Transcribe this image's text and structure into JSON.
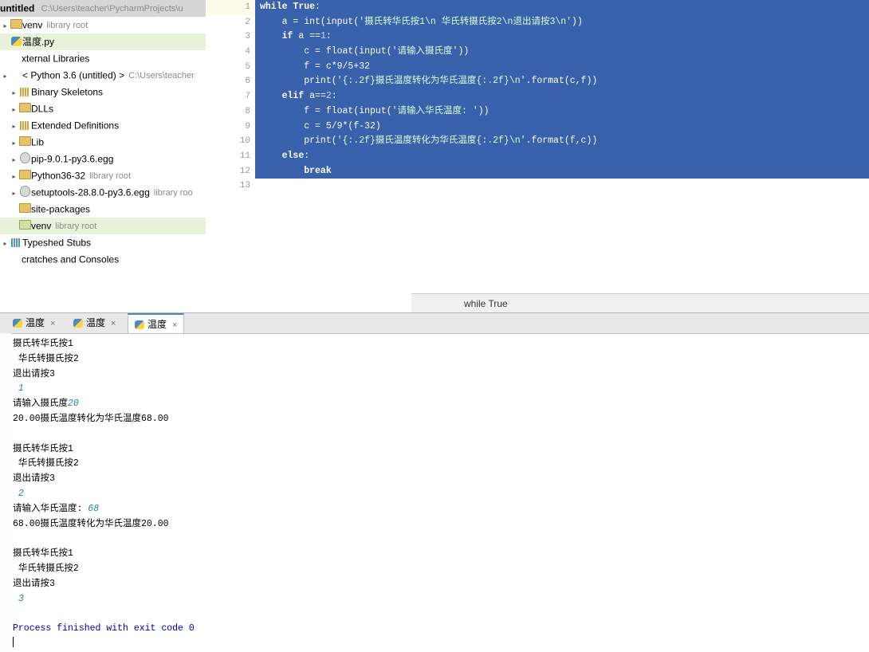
{
  "project": {
    "root_label": "untitled",
    "root_path": "C:\\Users\\teacher\\PycharmProjects\\u",
    "items": [
      {
        "label": "venv",
        "sub": "library root",
        "icon": "folder-icon",
        "indent": 1,
        "arrow": ">"
      },
      {
        "label": "温度.py",
        "sub": "",
        "icon": "python-file-icon",
        "indent": 1,
        "arrow": "",
        "selected": true
      },
      {
        "label": "xternal Libraries",
        "sub": "",
        "icon": "none",
        "indent": 0,
        "arrow": ""
      },
      {
        "label": "< Python 3.6 (untitled) >",
        "sub": "C:\\Users\\teacher",
        "icon": "none",
        "indent": 1,
        "arrow": ">"
      },
      {
        "label": "Binary Skeletons",
        "sub": "",
        "icon": "bars-icon",
        "indent": 2,
        "arrow": ">"
      },
      {
        "label": "DLLs",
        "sub": "",
        "icon": "folder-icon",
        "indent": 2,
        "arrow": ">"
      },
      {
        "label": "Extended Definitions",
        "sub": "",
        "icon": "bars-icon",
        "indent": 2,
        "arrow": ">"
      },
      {
        "label": "Lib",
        "sub": "",
        "icon": "folder-icon",
        "indent": 2,
        "arrow": ">"
      },
      {
        "label": "pip-9.0.1-py3.6.egg",
        "sub": "",
        "icon": "egg-icon",
        "indent": 2,
        "arrow": ">"
      },
      {
        "label": "Python36-32",
        "sub": "library root",
        "icon": "folder-icon",
        "indent": 2,
        "arrow": ">"
      },
      {
        "label": "setuptools-28.8.0-py3.6.egg",
        "sub": "library roo",
        "icon": "egg-icon",
        "indent": 2,
        "arrow": ">"
      },
      {
        "label": "site-packages",
        "sub": "",
        "icon": "folder-icon",
        "indent": 2,
        "arrow": ""
      },
      {
        "label": "venv",
        "sub": "library root",
        "icon": "folder-green-icon",
        "indent": 2,
        "arrow": "",
        "highlight": true
      },
      {
        "label": "Typeshed Stubs",
        "sub": "",
        "icon": "bars-blue-icon",
        "indent": 1,
        "arrow": ">"
      },
      {
        "label": "cratches and Consoles",
        "sub": "",
        "icon": "none",
        "indent": 0,
        "arrow": ""
      }
    ]
  },
  "editor": {
    "line_numbers": [
      "1",
      "2",
      "3",
      "4",
      "5",
      "6",
      "7",
      "8",
      "9",
      "10",
      "11",
      "12",
      "13"
    ],
    "breadcrumb": "while True",
    "lines": [
      {
        "n": 1,
        "indent": 0,
        "tokens": [
          {
            "t": "while ",
            "c": "kw"
          },
          {
            "t": "True",
            "c": "kw"
          },
          {
            "t": ":",
            "c": "plain"
          }
        ]
      },
      {
        "n": 2,
        "indent": 1,
        "tokens": [
          {
            "t": "a = int(input(",
            "c": "plain"
          },
          {
            "t": "'摄氏转华氏按1\\n 华氏转摄氏按2\\n退出请按3\\n'",
            "c": "str"
          },
          {
            "t": "))",
            "c": "plain"
          }
        ]
      },
      {
        "n": 3,
        "indent": 1,
        "tokens": [
          {
            "t": "if ",
            "c": "kw"
          },
          {
            "t": "a ==",
            "c": "plain"
          },
          {
            "t": "1",
            "c": "num"
          },
          {
            "t": ":",
            "c": "plain"
          }
        ]
      },
      {
        "n": 4,
        "indent": 2,
        "tokens": [
          {
            "t": "c = float(input(",
            "c": "plain"
          },
          {
            "t": "'请输入摄氏度'",
            "c": "str"
          },
          {
            "t": "))",
            "c": "plain"
          }
        ]
      },
      {
        "n": 5,
        "indent": 2,
        "tokens": [
          {
            "t": "f = c*9/5+32",
            "c": "plain"
          }
        ]
      },
      {
        "n": 6,
        "indent": 2,
        "tokens": [
          {
            "t": "print(",
            "c": "plain"
          },
          {
            "t": "'{:.2f}摄氏温度转化为华氏温度{:.2f}\\n'",
            "c": "str"
          },
          {
            "t": ".format(c,f))",
            "c": "plain"
          }
        ]
      },
      {
        "n": 7,
        "indent": 1,
        "tokens": [
          {
            "t": "elif ",
            "c": "kw"
          },
          {
            "t": "a==",
            "c": "plain"
          },
          {
            "t": "2",
            "c": "num"
          },
          {
            "t": ":",
            "c": "plain"
          }
        ]
      },
      {
        "n": 8,
        "indent": 2,
        "tokens": [
          {
            "t": "f = float(input(",
            "c": "plain"
          },
          {
            "t": "'请输入华氏温度: '",
            "c": "str"
          },
          {
            "t": "))",
            "c": "plain"
          }
        ]
      },
      {
        "n": 9,
        "indent": 2,
        "tokens": [
          {
            "t": "c = 5/9*(f-32)",
            "c": "plain"
          }
        ]
      },
      {
        "n": 10,
        "indent": 2,
        "tokens": [
          {
            "t": "print(",
            "c": "plain"
          },
          {
            "t": "'{:.2f}摄氏温度转化为华氏温度{:.2f}\\n'",
            "c": "str"
          },
          {
            "t": ".format(f,c))",
            "c": "plain"
          }
        ]
      },
      {
        "n": 11,
        "indent": 1,
        "tokens": [
          {
            "t": "else",
            "c": "kw"
          },
          {
            "t": ":",
            "c": "plain"
          }
        ]
      },
      {
        "n": 12,
        "indent": 2,
        "tokens": [
          {
            "t": "break",
            "c": "kw"
          }
        ]
      },
      {
        "n": 13,
        "indent": 0,
        "tokens": []
      }
    ]
  },
  "console": {
    "tabs": [
      {
        "label": "温度",
        "active": false
      },
      {
        "label": "温度",
        "active": false
      },
      {
        "label": "温度",
        "active": true
      }
    ],
    "close_glyph": "×",
    "output": [
      {
        "text": "摄氏转华氏按1",
        "kind": "plain"
      },
      {
        "text": " 华氏转摄氏按2",
        "kind": "plain"
      },
      {
        "text": "退出请按3",
        "kind": "plain"
      },
      {
        "text": " 1",
        "kind": "input"
      },
      {
        "text": "请输入摄氏度",
        "kind": "plain",
        "input_suffix": "20"
      },
      {
        "text": "20.00摄氏温度转化为华氏温度68.00",
        "kind": "plain"
      },
      {
        "text": "",
        "kind": "plain"
      },
      {
        "text": "摄氏转华氏按1",
        "kind": "plain"
      },
      {
        "text": " 华氏转摄氏按2",
        "kind": "plain"
      },
      {
        "text": "退出请按3",
        "kind": "plain"
      },
      {
        "text": " 2",
        "kind": "input"
      },
      {
        "text": "请输入华氏温度:",
        "kind": "plain",
        "input_suffix": " 68"
      },
      {
        "text": "68.00摄氏温度转化为华氏温度20.00",
        "kind": "plain"
      },
      {
        "text": "",
        "kind": "plain"
      },
      {
        "text": "摄氏转华氏按1",
        "kind": "plain"
      },
      {
        "text": " 华氏转摄氏按2",
        "kind": "plain"
      },
      {
        "text": "退出请按3",
        "kind": "plain"
      },
      {
        "text": " 3",
        "kind": "input"
      },
      {
        "text": "",
        "kind": "plain"
      },
      {
        "text": "Process finished with exit code 0",
        "kind": "result"
      }
    ]
  },
  "colors": {
    "selection_blue": "#3a61ab",
    "run_green": "#2aa02a",
    "keyword": "#000080",
    "string": "#008000",
    "number": "#0000ff",
    "sidebar_selection": "#e7f2d9"
  }
}
